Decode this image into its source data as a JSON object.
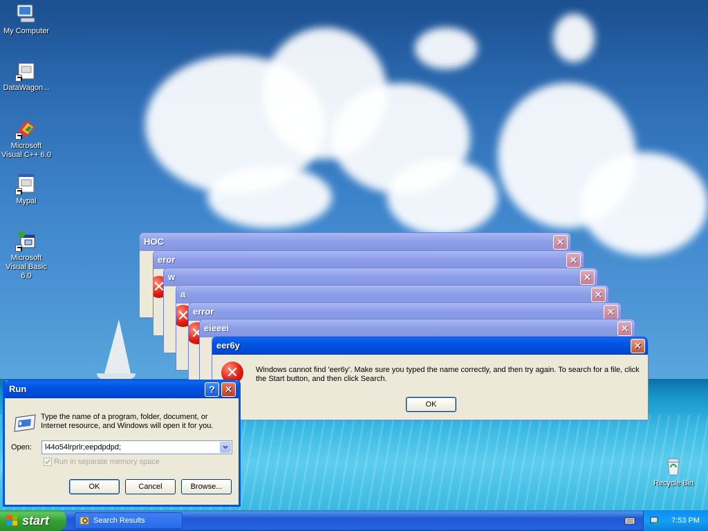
{
  "desktop": {
    "icons": [
      {
        "label": "My Computer",
        "icon": "computer-icon"
      },
      {
        "label": "DataWagon...",
        "icon": "program-shortcut-icon"
      },
      {
        "label": "Microsoft Visual C++ 6.0",
        "icon": "visual-cpp-icon"
      },
      {
        "label": "Mypal",
        "icon": "program-shortcut-icon"
      },
      {
        "label": "Microsoft Visual Basic 6.0",
        "icon": "visual-basic-icon"
      },
      {
        "label": "Recycle Bin",
        "icon": "recycle-bin-icon"
      }
    ]
  },
  "error_windows": [
    {
      "title": "HOC"
    },
    {
      "title": "eror"
    },
    {
      "title": "w"
    },
    {
      "title": "a"
    },
    {
      "title": "error"
    },
    {
      "title": "eieeei"
    },
    {
      "title": "eer6y"
    }
  ],
  "active_error": {
    "message": "Windows cannot find 'eer6y'. Make sure you typed the name correctly, and then try again. To search for a file, click the Start button, and then click Search.",
    "ok_label": "OK",
    "close_glyph": "✕"
  },
  "run_dialog": {
    "title": "Run",
    "help_glyph": "?",
    "close_glyph": "✕",
    "description": "Type the name of a program, folder, document, or Internet resource, and Windows will open it for you.",
    "open_label": "Open:",
    "open_value": "l44o54lrprlr;eepdpdpd;",
    "checkbox_label": "Run in separate memory space",
    "checkbox_checked": true,
    "ok_label": "OK",
    "cancel_label": "Cancel",
    "browse_label": "Browse..."
  },
  "taskbar": {
    "start_label": "start",
    "items": [
      {
        "label": "Search Results",
        "icon": "search-results-icon"
      }
    ],
    "clock": "7:53 PM"
  },
  "colors": {
    "title_active": "#0054e3",
    "title_inactive": "#8e9fe8",
    "close_red": "#c8553b",
    "dialog_bg": "#ece9d8",
    "taskbar_blue": "#2157d7",
    "start_green": "#37a037"
  }
}
